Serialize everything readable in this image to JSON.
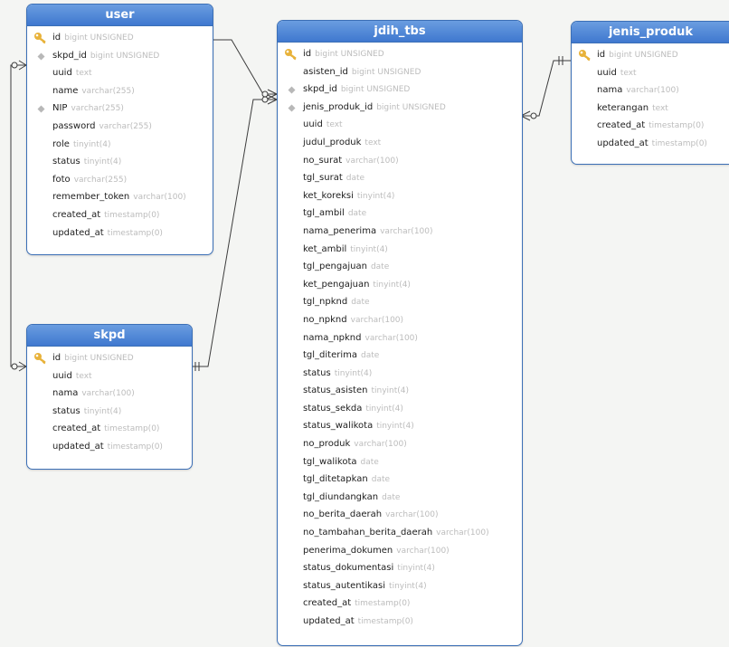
{
  "tables": {
    "user": {
      "title": "user",
      "columns": [
        {
          "name": "id",
          "type": "bigint UNSIGNED",
          "icon": "key-icon"
        },
        {
          "name": "skpd_id",
          "type": "bigint UNSIGNED",
          "icon": "index-icon"
        },
        {
          "name": "uuid",
          "type": "text",
          "icon": ""
        },
        {
          "name": "name",
          "type": "varchar(255)",
          "icon": ""
        },
        {
          "name": "NIP",
          "type": "varchar(255)",
          "icon": "index-icon"
        },
        {
          "name": "password",
          "type": "varchar(255)",
          "icon": ""
        },
        {
          "name": "role",
          "type": "tinyint(4)",
          "icon": ""
        },
        {
          "name": "status",
          "type": "tinyint(4)",
          "icon": ""
        },
        {
          "name": "foto",
          "type": "varchar(255)",
          "icon": ""
        },
        {
          "name": "remember_token",
          "type": "varchar(100)",
          "icon": ""
        },
        {
          "name": "created_at",
          "type": "timestamp(0)",
          "icon": ""
        },
        {
          "name": "updated_at",
          "type": "timestamp(0)",
          "icon": ""
        }
      ]
    },
    "skpd": {
      "title": "skpd",
      "columns": [
        {
          "name": "id",
          "type": "bigint UNSIGNED",
          "icon": "key-icon"
        },
        {
          "name": "uuid",
          "type": "text",
          "icon": ""
        },
        {
          "name": "nama",
          "type": "varchar(100)",
          "icon": ""
        },
        {
          "name": "status",
          "type": "tinyint(4)",
          "icon": ""
        },
        {
          "name": "created_at",
          "type": "timestamp(0)",
          "icon": ""
        },
        {
          "name": "updated_at",
          "type": "timestamp(0)",
          "icon": ""
        }
      ]
    },
    "jdih_tbs": {
      "title": "jdih_tbs",
      "columns": [
        {
          "name": "id",
          "type": "bigint UNSIGNED",
          "icon": "key-icon"
        },
        {
          "name": "asisten_id",
          "type": "bigint UNSIGNED",
          "icon": ""
        },
        {
          "name": "skpd_id",
          "type": "bigint UNSIGNED",
          "icon": "index-icon"
        },
        {
          "name": "jenis_produk_id",
          "type": "bigint UNSIGNED",
          "icon": "index-icon"
        },
        {
          "name": "uuid",
          "type": "text",
          "icon": ""
        },
        {
          "name": "judul_produk",
          "type": "text",
          "icon": ""
        },
        {
          "name": "no_surat",
          "type": "varchar(100)",
          "icon": ""
        },
        {
          "name": "tgl_surat",
          "type": "date",
          "icon": ""
        },
        {
          "name": "ket_koreksi",
          "type": "tinyint(4)",
          "icon": ""
        },
        {
          "name": "tgl_ambil",
          "type": "date",
          "icon": ""
        },
        {
          "name": "nama_penerima",
          "type": "varchar(100)",
          "icon": ""
        },
        {
          "name": "ket_ambil",
          "type": "tinyint(4)",
          "icon": ""
        },
        {
          "name": "tgl_pengajuan",
          "type": "date",
          "icon": ""
        },
        {
          "name": "ket_pengajuan",
          "type": "tinyint(4)",
          "icon": ""
        },
        {
          "name": "tgl_npknd",
          "type": "date",
          "icon": ""
        },
        {
          "name": "no_npknd",
          "type": "varchar(100)",
          "icon": ""
        },
        {
          "name": "nama_npknd",
          "type": "varchar(100)",
          "icon": ""
        },
        {
          "name": "tgl_diterima",
          "type": "date",
          "icon": ""
        },
        {
          "name": "status",
          "type": "tinyint(4)",
          "icon": ""
        },
        {
          "name": "status_asisten",
          "type": "tinyint(4)",
          "icon": ""
        },
        {
          "name": "status_sekda",
          "type": "tinyint(4)",
          "icon": ""
        },
        {
          "name": "status_walikota",
          "type": "tinyint(4)",
          "icon": ""
        },
        {
          "name": "no_produk",
          "type": "varchar(100)",
          "icon": ""
        },
        {
          "name": "tgl_walikota",
          "type": "date",
          "icon": ""
        },
        {
          "name": "tgl_ditetapkan",
          "type": "date",
          "icon": ""
        },
        {
          "name": "tgl_diundangkan",
          "type": "date",
          "icon": ""
        },
        {
          "name": "no_berita_daerah",
          "type": "varchar(100)",
          "icon": ""
        },
        {
          "name": "no_tambahan_berita_daerah",
          "type": "varchar(100)",
          "icon": ""
        },
        {
          "name": "penerima_dokumen",
          "type": "varchar(100)",
          "icon": ""
        },
        {
          "name": "status_dokumentasi",
          "type": "tinyint(4)",
          "icon": ""
        },
        {
          "name": "status_autentikasi",
          "type": "tinyint(4)",
          "icon": ""
        },
        {
          "name": "created_at",
          "type": "timestamp(0)",
          "icon": ""
        },
        {
          "name": "updated_at",
          "type": "timestamp(0)",
          "icon": ""
        }
      ]
    },
    "jenis_produk": {
      "title": "jenis_produk",
      "columns": [
        {
          "name": "id",
          "type": "bigint UNSIGNED",
          "icon": "key-icon"
        },
        {
          "name": "uuid",
          "type": "text",
          "icon": ""
        },
        {
          "name": "nama",
          "type": "varchar(100)",
          "icon": ""
        },
        {
          "name": "keterangan",
          "type": "text",
          "icon": ""
        },
        {
          "name": "created_at",
          "type": "timestamp(0)",
          "icon": ""
        },
        {
          "name": "updated_at",
          "type": "timestamp(0)",
          "icon": ""
        }
      ]
    }
  },
  "colors": {
    "header_top": "#6a9de0",
    "header_bottom": "#3f78cf",
    "border": "#3b6fb6",
    "column_type": "#bcbcbc",
    "key_icon": "#e8b23a",
    "index_icon": "#b8b8b8",
    "connector": "#3c3c3c"
  },
  "relationships": [
    {
      "from": "user",
      "to": "jdih_tbs",
      "from_end": "one-and-only-one",
      "to_end": "zero-or-many"
    },
    {
      "from": "user",
      "to": "skpd",
      "from_end": "zero-or-many",
      "to_end": "zero-or-many"
    },
    {
      "from": "skpd",
      "to": "jdih_tbs",
      "from_end": "one-and-only-one",
      "to_end": "zero-or-many"
    },
    {
      "from": "jenis_produk",
      "to": "jdih_tbs",
      "from_end": "one-and-only-one",
      "to_end": "zero-or-many"
    }
  ]
}
